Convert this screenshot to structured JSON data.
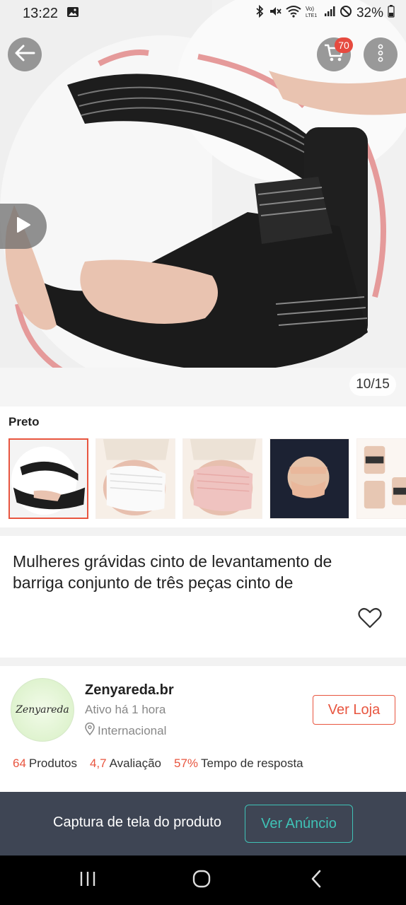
{
  "status_bar": {
    "time": "13:22",
    "battery": "32%",
    "icons": [
      "gallery-icon",
      "bluetooth-icon",
      "mute-icon",
      "wifi-icon",
      "volte-icon",
      "signal-icon",
      "no-disturb-icon",
      "battery-icon"
    ]
  },
  "hero": {
    "counter": "10/15",
    "cart_count": "70",
    "icons": [
      "back-arrow-icon",
      "cart-icon",
      "more-vertical-icon",
      "play-icon"
    ]
  },
  "variant": {
    "label": "Preto",
    "thumbnails": [
      "Preto",
      "Branco",
      "Rosa",
      "Bege",
      "Conjunto"
    ],
    "selected_index": 0
  },
  "product": {
    "title": "Mulheres grávidas cinto de levantamento de barriga conjunto de três peças cinto de"
  },
  "store": {
    "logo_text": "Zenyareda",
    "name": "Zenyareda.br",
    "active": "Ativo há 1 hora",
    "location": "Internacional",
    "visit_label": "Ver Loja",
    "stats": [
      {
        "value": "64",
        "label": "Produtos"
      },
      {
        "value": "4,7",
        "label": "Avaliação"
      },
      {
        "value": "57%",
        "label": "Tempo de resposta"
      }
    ]
  },
  "banner": {
    "text": "Captura de tela do produto",
    "button": "Ver Anúncio"
  },
  "colors": {
    "accent": "#e8553f",
    "banner_bg": "#3e4554",
    "banner_accent": "#3fc2b6"
  }
}
